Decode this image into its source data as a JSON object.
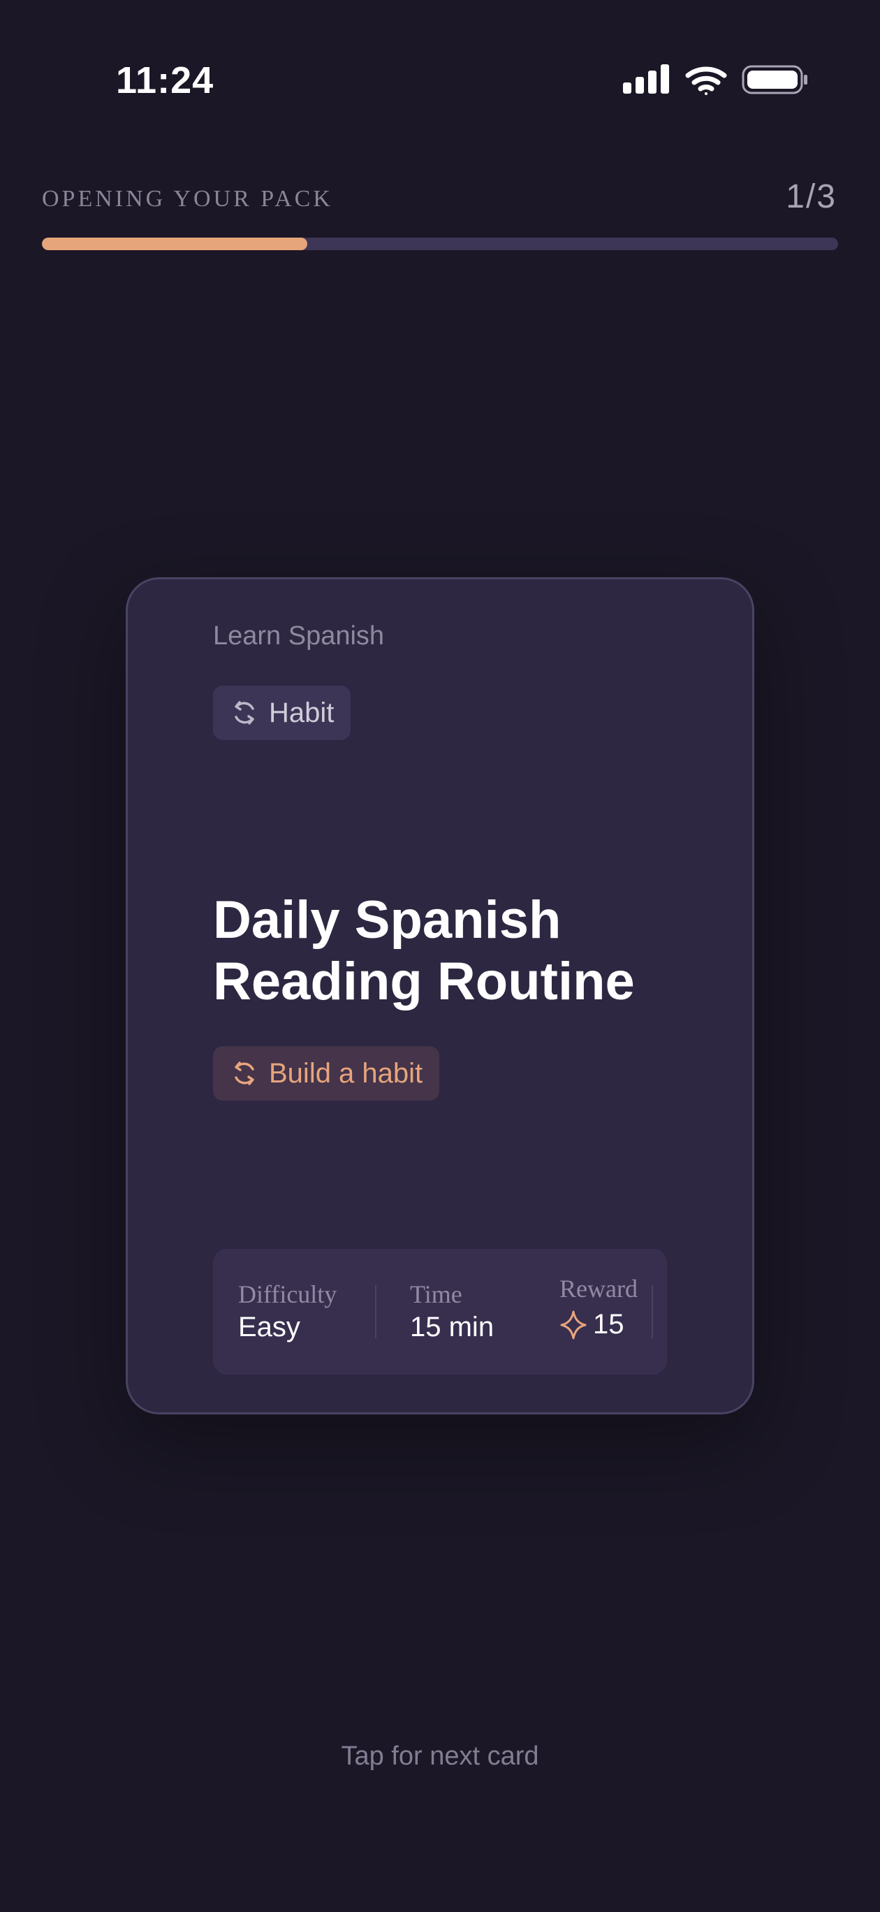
{
  "status_bar": {
    "time": "11:24",
    "icons": [
      "signal-icon",
      "wifi-icon",
      "battery-icon"
    ]
  },
  "header": {
    "label": "OPENING YOUR PACK",
    "count": "1/3",
    "progress_fraction": 0.333
  },
  "card": {
    "subject": "Learn Spanish",
    "type_label": "Habit",
    "type_icon": "refresh-icon",
    "title_line1": "Daily Spanish",
    "title_line2": "Reading Routine",
    "goal_label": "Build a habit",
    "goal_icon": "refresh-icon",
    "stats": {
      "difficulty_label": "Difficulty",
      "difficulty_value": "Easy",
      "time_label": "Time",
      "time_value": "15 min",
      "reward_label": "Reward",
      "reward_value": "15",
      "reward_icon": "sparkle-icon"
    }
  },
  "footer": {
    "hint": "Tap for next card"
  },
  "colors": {
    "background": "#1b1726",
    "card": "#2d2741",
    "accent": "#e7a57c",
    "progress_track": "#3d3656"
  }
}
